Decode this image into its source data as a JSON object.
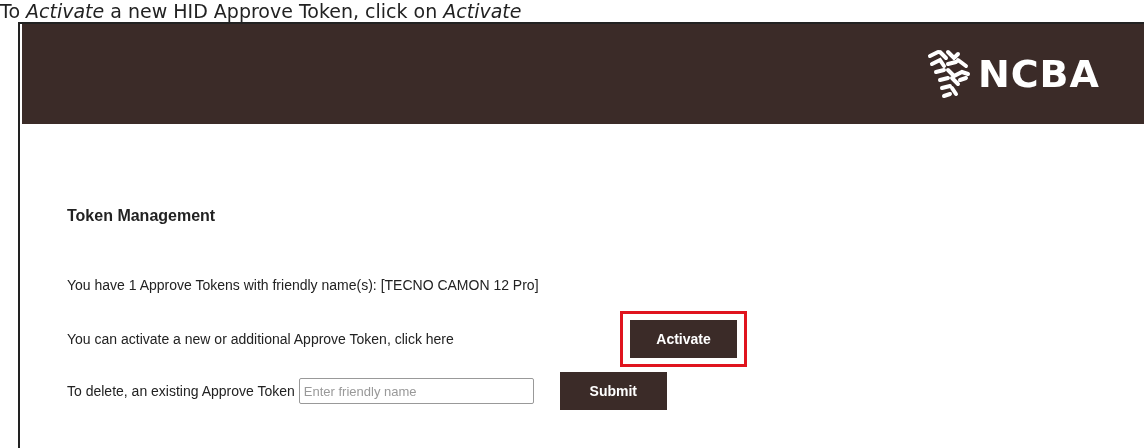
{
  "caption": "To *Activate* a new HID Approve Token, click on *Activate*",
  "header": {
    "logo_text": "NCBA"
  },
  "section_title": "Token Management",
  "info": "You have 1 Approve Tokens with friendly name(s): [TECNO CAMON 12 Pro]",
  "activate_row": {
    "label": "You can activate a new or additional Approve Token, click here",
    "button": "Activate",
    "highlighted": true
  },
  "delete_row": {
    "label": "To delete, an existing Approve Token",
    "placeholder": "Enter friendly name",
    "button": "Submit",
    "highlighted": false
  }
}
